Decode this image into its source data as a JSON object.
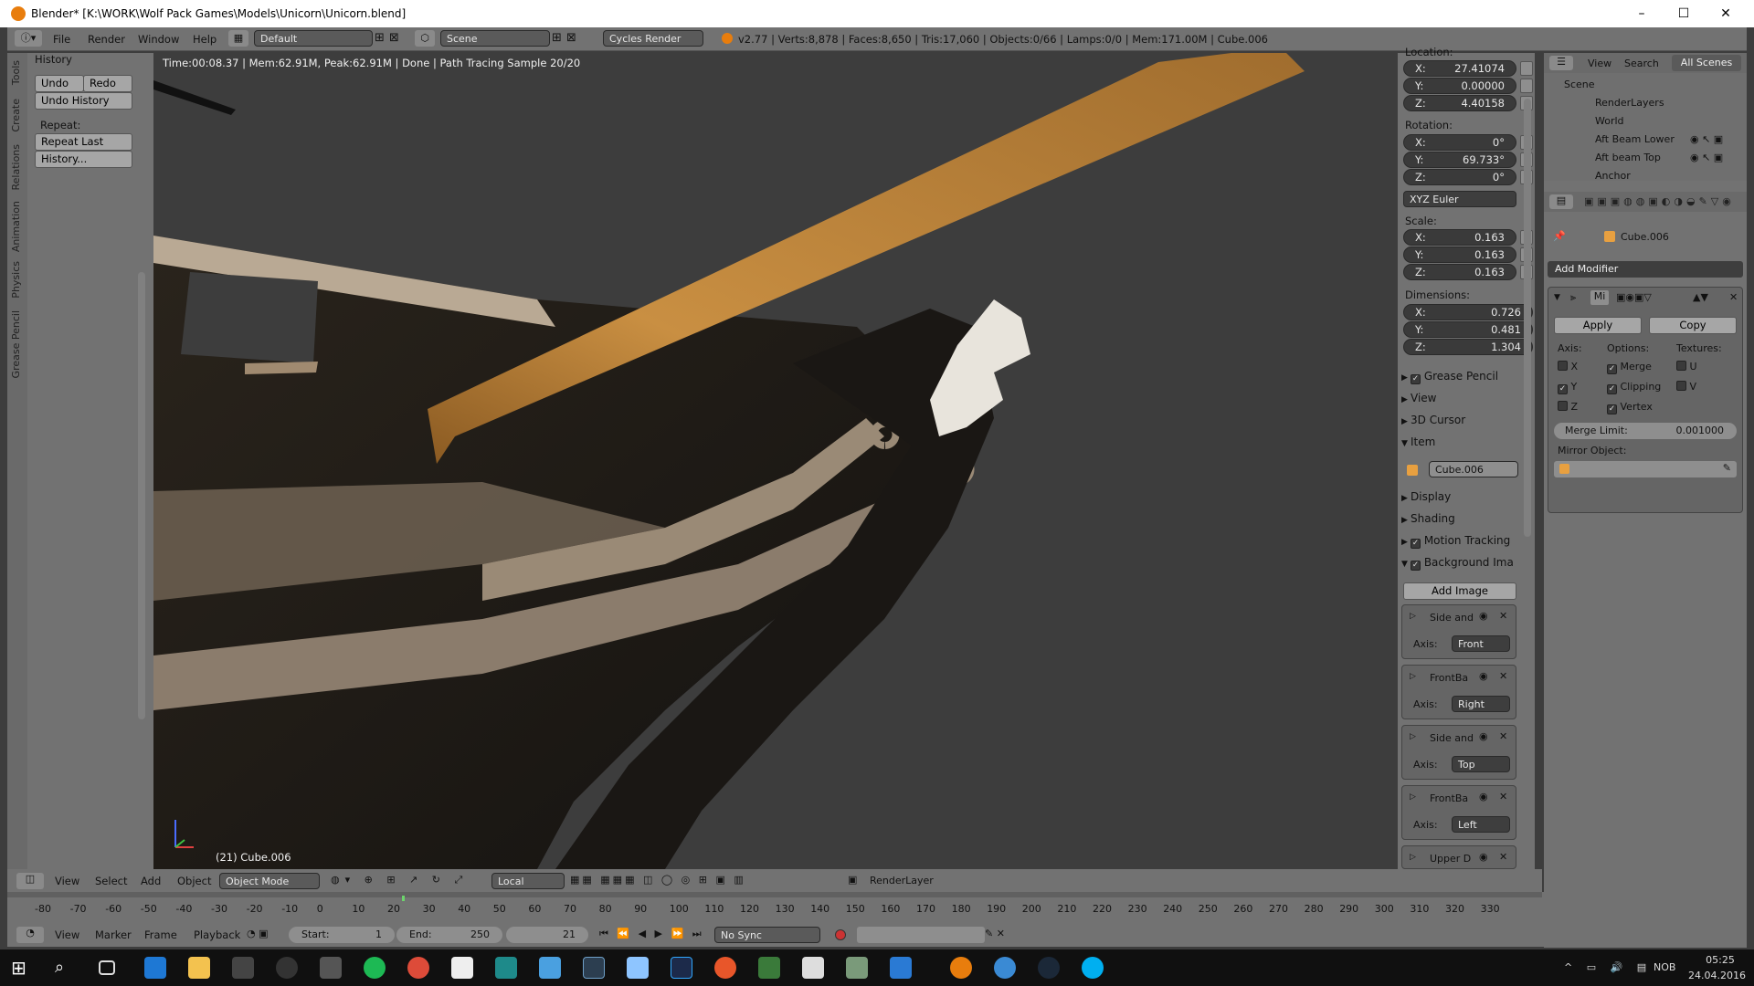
{
  "window": {
    "title": "Blender* [K:\\WORK\\Wolf Pack Games\\Models\\Unicorn\\Unicorn.blend]",
    "minimize": "–",
    "maximize": "☐",
    "close": "✕"
  },
  "menus": [
    "File",
    "Render",
    "Window",
    "Help"
  ],
  "screen_layout": "Default",
  "scene": "Scene",
  "render_engine": "Cycles Render",
  "stats": "v2.77 | Verts:8,878 | Faces:8,650 | Tris:17,060 | Objects:0/66 | Lamps:0/0 | Mem:171.00M | Cube.006",
  "viewport": {
    "status": "Time:00:08.37 | Mem:62.91M, Peak:62.91M | Done | Path Tracing Sample 20/20",
    "object_label": "(21) Cube.006"
  },
  "tool_tabs": [
    "Tools",
    "Create",
    "Relations",
    "Animation",
    "Physics",
    "Grease Pencil"
  ],
  "history_panel": {
    "title": "History",
    "undo": "Undo",
    "redo": "Redo",
    "undo_history": "Undo History",
    "repeat_label": "Repeat:",
    "repeat_last": "Repeat Last",
    "history": "History..."
  },
  "transform": {
    "location_label": "Location:",
    "location": [
      {
        "axis": "X:",
        "value": "27.41074"
      },
      {
        "axis": "Y:",
        "value": "0.00000"
      },
      {
        "axis": "Z:",
        "value": "4.40158"
      }
    ],
    "rotation_label": "Rotation:",
    "rotation": [
      {
        "axis": "X:",
        "value": "0°"
      },
      {
        "axis": "Y:",
        "value": "69.733°"
      },
      {
        "axis": "Z:",
        "value": "0°"
      }
    ],
    "rotation_mode": "XYZ Euler",
    "scale_label": "Scale:",
    "scale": [
      {
        "axis": "X:",
        "value": "0.163"
      },
      {
        "axis": "Y:",
        "value": "0.163"
      },
      {
        "axis": "Z:",
        "value": "0.163"
      }
    ],
    "dimensions_label": "Dimensions:",
    "dimensions": [
      {
        "axis": "X:",
        "value": "0.726"
      },
      {
        "axis": "Y:",
        "value": "0.481"
      },
      {
        "axis": "Z:",
        "value": "1.304"
      }
    ]
  },
  "npanel_sections": {
    "grease_pencil": "Grease Pencil",
    "view": "View",
    "cursor": "3D Cursor",
    "item": "Item",
    "item_name": "Cube.006",
    "display": "Display",
    "shading": "Shading",
    "motion_tracking": "Motion Tracking",
    "background_images": "Background Ima",
    "add_image": "Add Image"
  },
  "background_images": [
    {
      "name": "Side and",
      "axis_label": "Axis:",
      "axis": "Front"
    },
    {
      "name": "FrontBa",
      "axis_label": "Axis:",
      "axis": "Right"
    },
    {
      "name": "Side and",
      "axis_label": "Axis:",
      "axis": "Top"
    },
    {
      "name": "FrontBa",
      "axis_label": "Axis:",
      "axis": "Left"
    },
    {
      "name": "Upper D"
    }
  ],
  "outliner": {
    "view": "View",
    "search": "Search",
    "all_scenes": "All Scenes",
    "items": [
      "Scene",
      "RenderLayers",
      "World",
      "Aft Beam Lower",
      "Aft beam Top",
      "Anchor"
    ]
  },
  "properties": {
    "object": "Cube.006",
    "add_modifier": "Add Modifier",
    "modifier_name": "Mi",
    "apply": "Apply",
    "copy": "Copy",
    "axis_label": "Axis:",
    "options_label": "Options:",
    "textures_label": "Textures:",
    "axis": [
      {
        "label": "X",
        "checked": false
      },
      {
        "label": "Y",
        "checked": true
      },
      {
        "label": "Z",
        "checked": false
      }
    ],
    "options": [
      {
        "label": "Merge",
        "checked": true
      },
      {
        "label": "Clipping",
        "checked": true
      },
      {
        "label": "Vertex",
        "checked": true
      }
    ],
    "textures": [
      {
        "label": "U",
        "checked": false
      },
      {
        "label": "V",
        "checked": false
      }
    ],
    "merge_limit_label": "Merge Limit:",
    "merge_limit": "0.001000",
    "mirror_object_label": "Mirror Object:"
  },
  "viewport_header": {
    "view": "View",
    "select": "Select",
    "add": "Add",
    "object": "Object",
    "mode": "Object Mode",
    "orientation": "Local",
    "render_layer": "RenderLayer"
  },
  "timeline": {
    "ticks": [
      "-80",
      "-70",
      "-60",
      "-50",
      "-40",
      "-30",
      "-20",
      "-10",
      "0",
      "10",
      "20",
      "30",
      "40",
      "50",
      "60",
      "70",
      "80",
      "90",
      "100",
      "110",
      "120",
      "130",
      "140",
      "150",
      "160",
      "170",
      "180",
      "190",
      "200",
      "210",
      "220",
      "230",
      "240",
      "250",
      "260",
      "270",
      "280",
      "290",
      "300",
      "310",
      "320",
      "330"
    ]
  },
  "playback": {
    "view": "View",
    "marker": "Marker",
    "frame": "Frame",
    "playback": "Playback",
    "start_label": "Start:",
    "start": "1",
    "end_label": "End:",
    "end": "250",
    "current": "21",
    "sync": "No Sync"
  },
  "taskbar": {
    "time": "05:25",
    "date": "24.04.2016",
    "lang": "NOB"
  },
  "colors": {
    "blender_orange": "#e87d0d",
    "ui_gray": "#727272",
    "viewport_bg": "#3d3d3d"
  }
}
